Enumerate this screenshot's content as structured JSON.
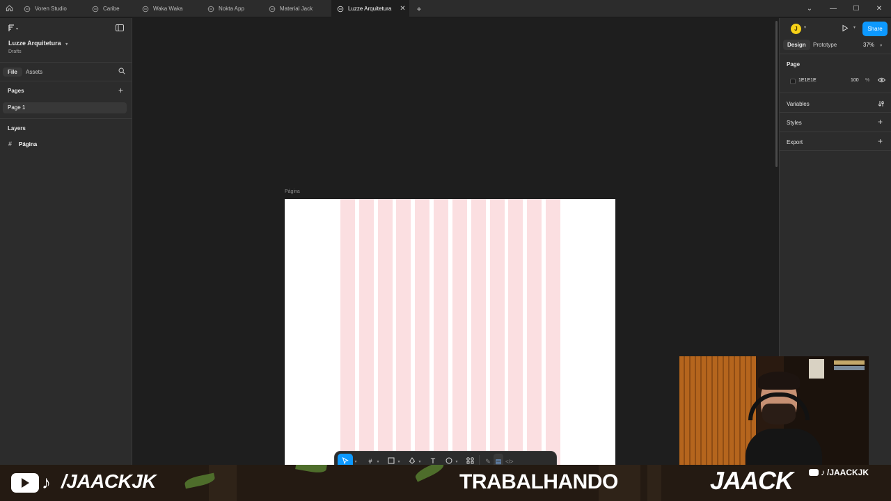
{
  "tabs": [
    {
      "label": "Voren Studio",
      "icon": "figma-file-icon"
    },
    {
      "label": "Caribe",
      "icon": "figma-file-icon"
    },
    {
      "label": "Waka Waka",
      "icon": "figma-file-icon"
    },
    {
      "label": "Nokta App",
      "icon": "figma-file-icon"
    },
    {
      "label": "Material Jack",
      "icon": "figma-file-icon"
    },
    {
      "label": "Luzze Arquitetura",
      "icon": "figma-file-icon",
      "active": true
    }
  ],
  "file": {
    "name": "Luzze Arquitetura",
    "location": "Drafts"
  },
  "left_panel": {
    "tab_file": "File",
    "tab_assets": "Assets",
    "pages_title": "Pages",
    "pages": [
      "Page 1"
    ],
    "layers_title": "Layers",
    "layers": [
      {
        "name": "Página",
        "icon": "frame-hash-icon"
      }
    ]
  },
  "canvas": {
    "frame_label": "Página",
    "frame_bg": "#FFFFFF",
    "grid_color": "#FBDFE1",
    "grid_columns": 12
  },
  "right_panel": {
    "avatar_initial": "J",
    "share_label": "Share",
    "tab_design": "Design",
    "tab_prototype": "Prototype",
    "zoom": "37%",
    "page_title": "Page",
    "page_color": "1E1E1E",
    "page_opacity": "100",
    "percent": "%",
    "variables": "Variables",
    "styles": "Styles",
    "export": "Export"
  },
  "toolbar": {
    "tools": [
      "move-icon",
      "frame-icon",
      "rectangle-icon",
      "pen-icon",
      "text-icon",
      "comment-icon",
      "resources-icon",
      "draw-mode-icon",
      "design-mode-icon",
      "dev-mode-icon"
    ]
  },
  "stream_overlay": {
    "handle": "/JAACKJK",
    "status": "TRABALHANDO",
    "brand": "JAACK",
    "small_handle": "/JAACKJK"
  },
  "colors": {
    "accent": "#0D99FF",
    "panel": "#2C2C2C",
    "canvas": "#1E1E1E"
  }
}
